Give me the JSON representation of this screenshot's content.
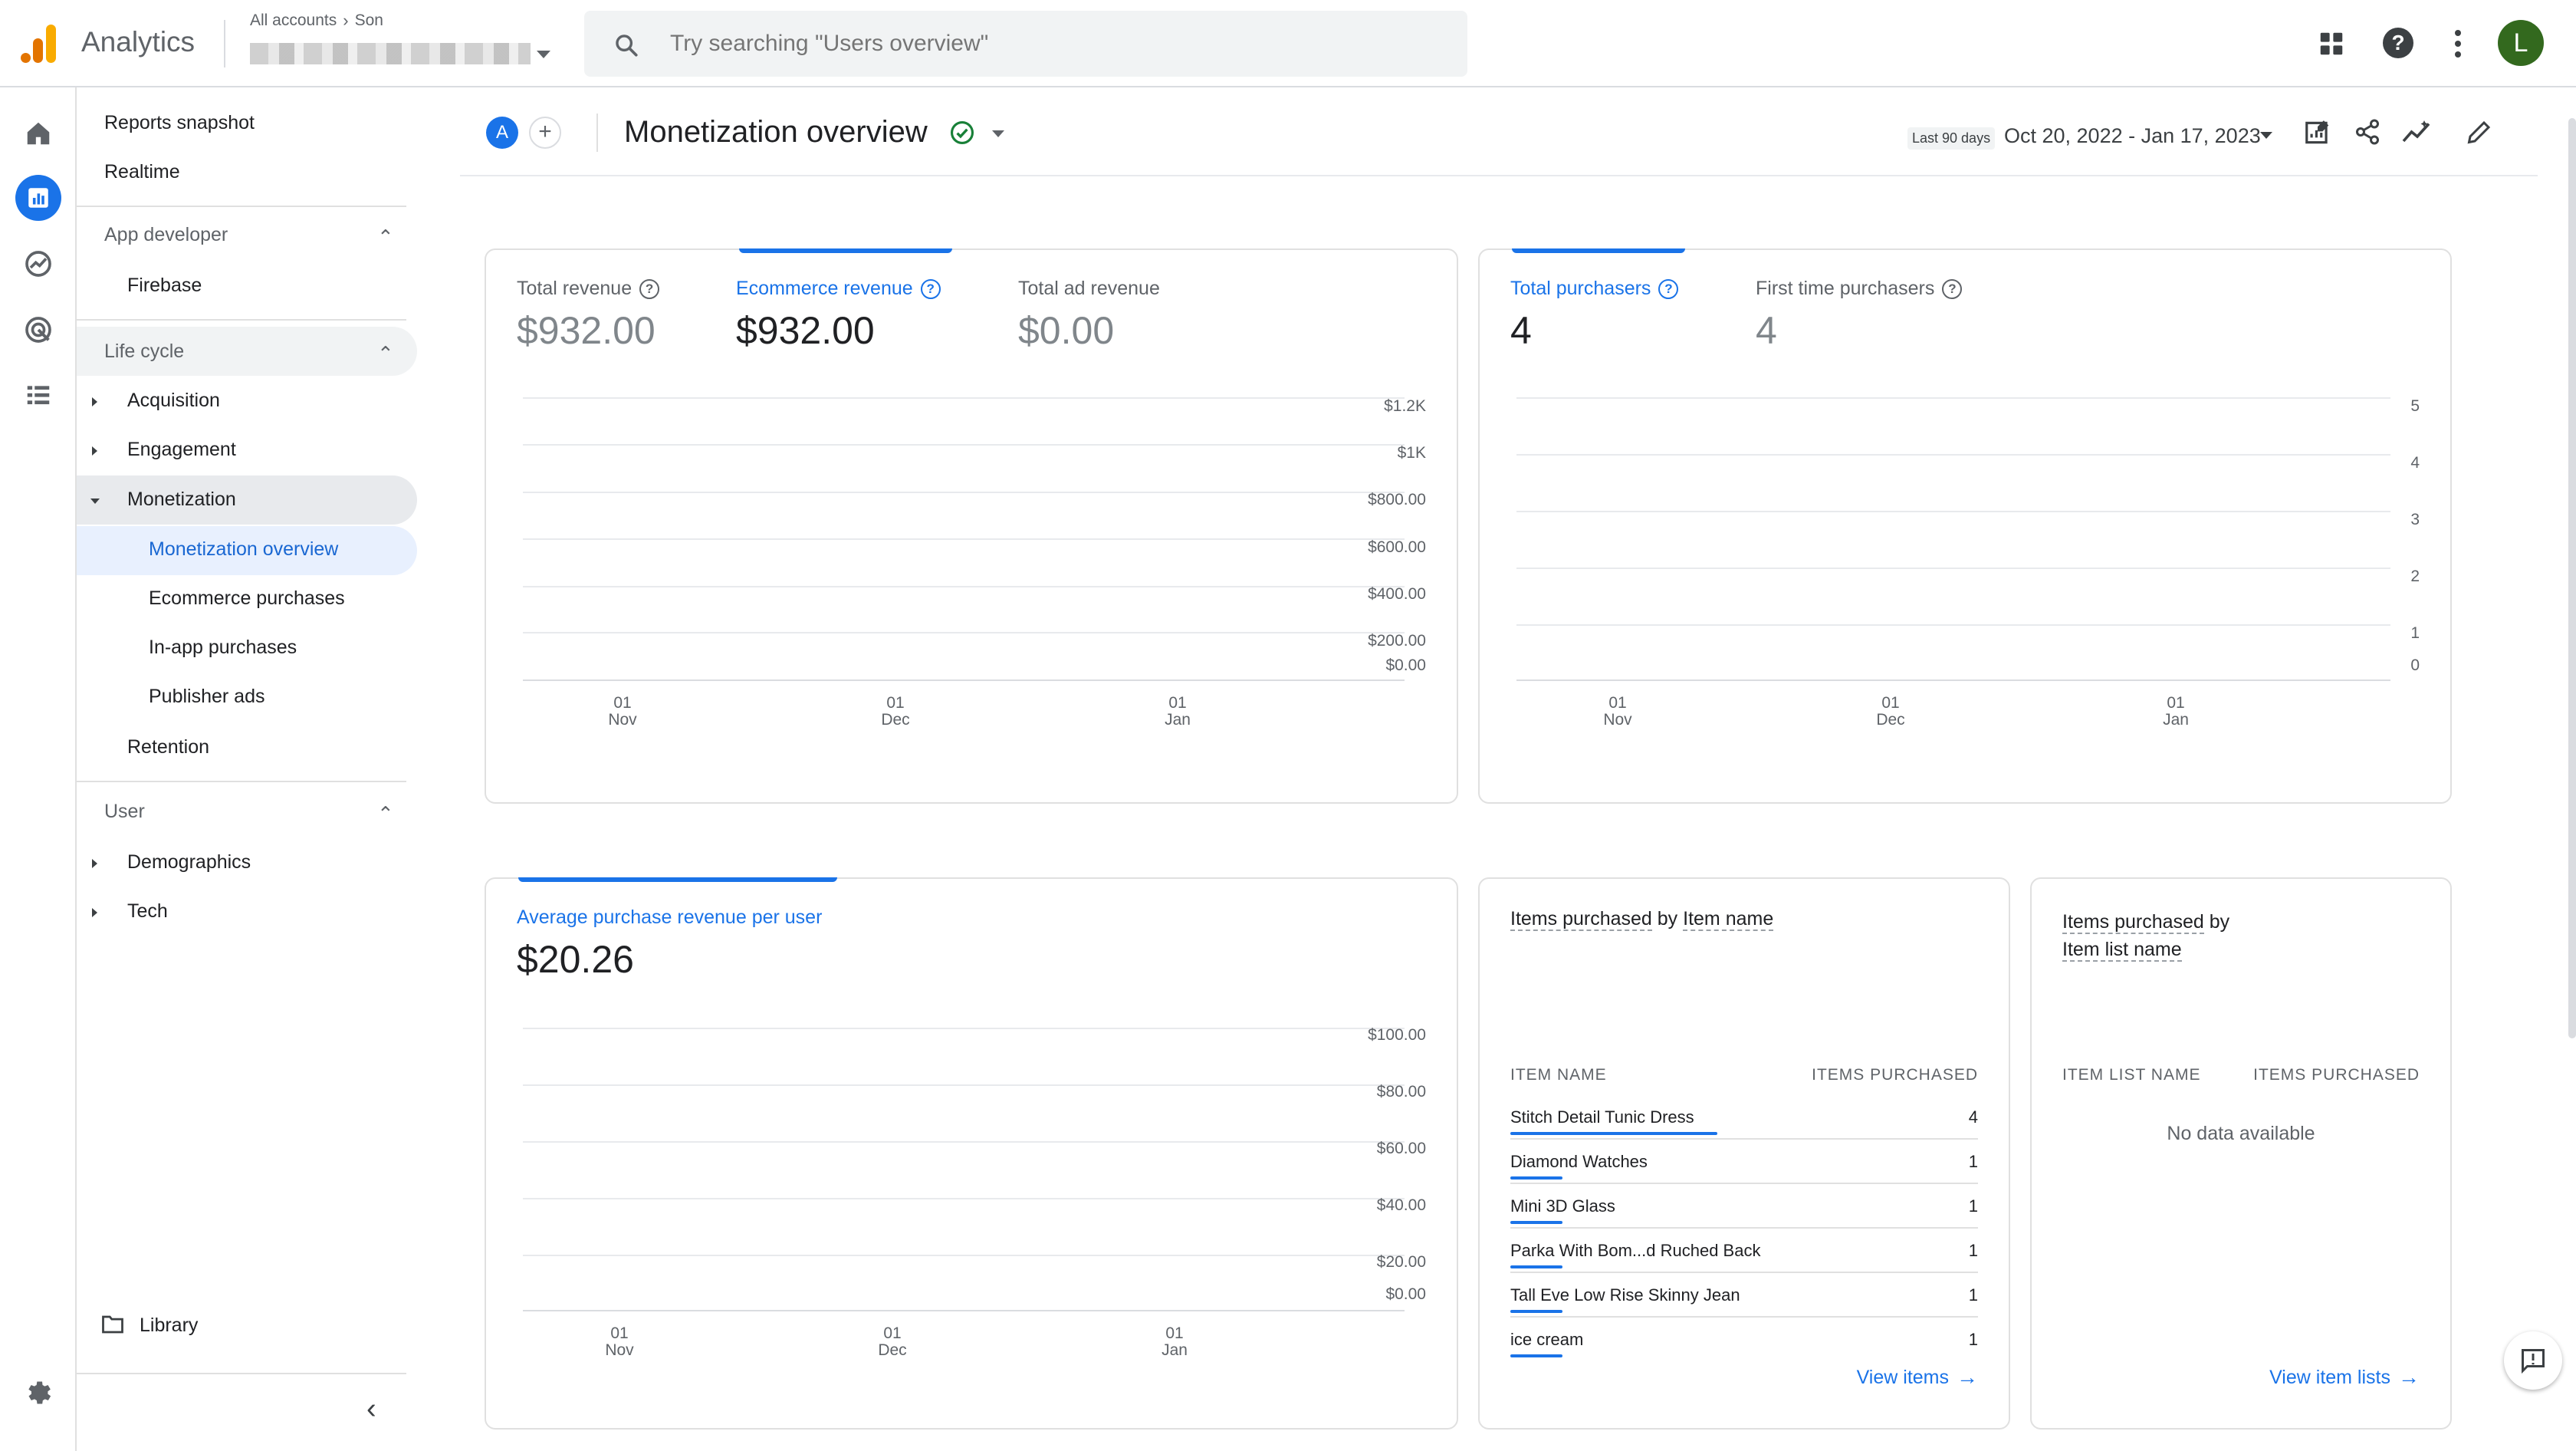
{
  "app": {
    "name": "Analytics",
    "account_breadcrumb_root": "All accounts",
    "account_breadcrumb_child": "Son",
    "search_placeholder": "Try searching \"Users overview\"",
    "avatar_letter": "L"
  },
  "nav": {
    "reports_snapshot": "Reports snapshot",
    "realtime": "Realtime",
    "app_developer": "App developer",
    "firebase": "Firebase",
    "life_cycle": "Life cycle",
    "acquisition": "Acquisition",
    "engagement": "Engagement",
    "monetization": "Monetization",
    "monetization_overview": "Monetization overview",
    "ecommerce_purchases": "Ecommerce purchases",
    "inapp_purchases": "In-app purchases",
    "publisher_ads": "Publisher ads",
    "retention": "Retention",
    "user": "User",
    "demographics": "Demographics",
    "tech": "Tech",
    "library": "Library"
  },
  "header": {
    "comparison_letter": "A",
    "title": "Monetization overview",
    "date_range_label": "Last 90 days",
    "date_range": "Oct 20, 2022 - Jan 17, 2023"
  },
  "revenue_card": {
    "metrics": [
      {
        "label": "Total revenue",
        "value": "$932.00"
      },
      {
        "label": "Ecommerce revenue",
        "value": "$932.00",
        "selected": true
      },
      {
        "label": "Total ad revenue",
        "value": "$0.00"
      }
    ],
    "y_ticks": [
      "$1.2K",
      "$1K",
      "$800.00",
      "$600.00",
      "$400.00",
      "$200.00",
      "$0.00"
    ],
    "x_ticks": [
      [
        "01",
        "Nov"
      ],
      [
        "01",
        "Dec"
      ],
      [
        "01",
        "Jan"
      ]
    ]
  },
  "purchasers_card": {
    "metrics": [
      {
        "label": "Total purchasers",
        "value": "4",
        "selected": true
      },
      {
        "label": "First time purchasers",
        "value": "4"
      }
    ],
    "y_ticks": [
      "5",
      "4",
      "3",
      "2",
      "1",
      "0"
    ],
    "x_ticks": [
      [
        "01",
        "Nov"
      ],
      [
        "01",
        "Dec"
      ],
      [
        "01",
        "Jan"
      ]
    ]
  },
  "arpu_card": {
    "label": "Average purchase revenue per user",
    "value": "$20.26",
    "y_ticks": [
      "$100.00",
      "$80.00",
      "$60.00",
      "$40.00",
      "$20.00",
      "$0.00"
    ],
    "x_ticks": [
      [
        "01",
        "Nov"
      ],
      [
        "01",
        "Dec"
      ],
      [
        "01",
        "Jan"
      ]
    ]
  },
  "items_card": {
    "title_a": "Items purchased",
    "title_by": "by",
    "title_b": "Item name",
    "col1": "ITEM NAME",
    "col2": "ITEMS PURCHASED",
    "rows": [
      {
        "name": "Stitch Detail Tunic Dress",
        "count": "4",
        "share": 1.0
      },
      {
        "name": "Diamond Watches",
        "count": "1",
        "share": 0.25
      },
      {
        "name": "Mini 3D Glass",
        "count": "1",
        "share": 0.25
      },
      {
        "name": "Parka With Bom...d Ruched Back",
        "count": "1",
        "share": 0.25
      },
      {
        "name": "Tall Eve Low Rise Skinny Jean",
        "count": "1",
        "share": 0.25
      },
      {
        "name": "ice cream",
        "count": "1",
        "share": 0.25
      }
    ],
    "link": "View items"
  },
  "item_lists_card": {
    "title_a": "Items purchased",
    "title_by": "by",
    "title_b": "Item list name",
    "col1": "ITEM LIST NAME",
    "col2": "ITEMS PURCHASED",
    "empty": "No data available",
    "link": "View item lists"
  },
  "colors": {
    "accent": "#1a73e8",
    "logo_orange": "#f9ab00",
    "logo_dark": "#e37400",
    "check_green": "#188038",
    "avatar_bg": "#33691e"
  }
}
